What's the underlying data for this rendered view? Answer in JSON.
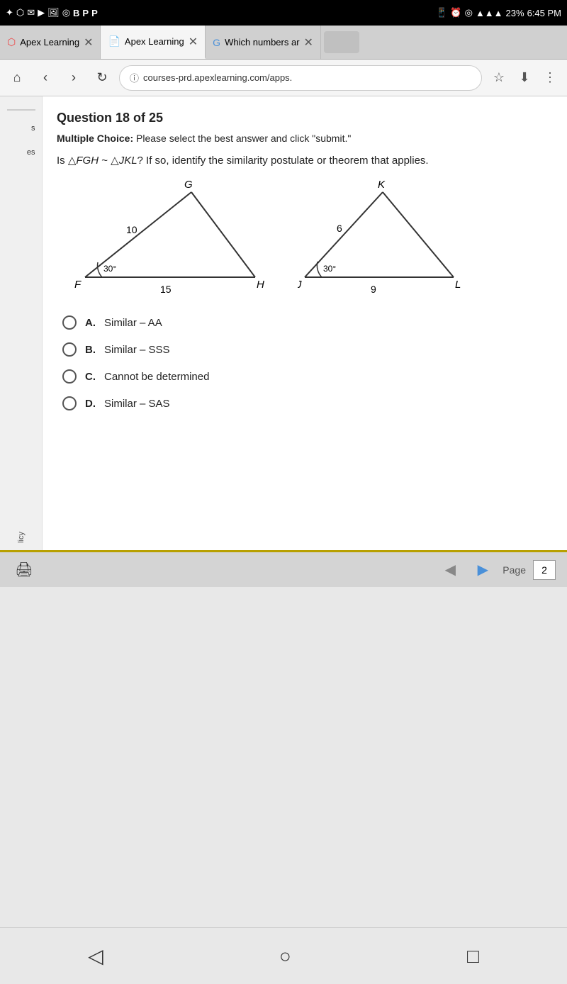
{
  "statusBar": {
    "time": "6:45 PM",
    "battery": "23%",
    "signal": "●●●"
  },
  "tabs": [
    {
      "id": "tab1",
      "label": "Apex Learning",
      "icon": "apex",
      "active": false
    },
    {
      "id": "tab2",
      "label": "Apex Learning",
      "icon": "doc",
      "active": true
    },
    {
      "id": "tab3",
      "label": "Which numbers ar",
      "icon": "google",
      "active": false
    }
  ],
  "addressBar": {
    "url": "courses-prd.apexlearning.com/apps."
  },
  "question": {
    "title": "Question 18 of 25",
    "instruction_bold": "Multiple Choice:",
    "instruction_text": " Please select the best answer and click \"submit.\"",
    "text": "Is △FGH ~ △JKL? If so, identify the similarity postulate or theorem that applies.",
    "triangle1": {
      "vertices": {
        "top": "G",
        "left": "F",
        "right": "H"
      },
      "sides": {
        "left": "10",
        "bottom": "15"
      },
      "angle": "30°"
    },
    "triangle2": {
      "vertices": {
        "top": "K",
        "left": "J",
        "right": "L"
      },
      "sides": {
        "left": "6",
        "bottom": "9"
      },
      "angle": "30°"
    },
    "choices": [
      {
        "letter": "A.",
        "text": "Similar – AA"
      },
      {
        "letter": "B.",
        "text": "Similar – SSS"
      },
      {
        "letter": "C.",
        "text": "Cannot be determined"
      },
      {
        "letter": "D.",
        "text": "Similar – SAS"
      }
    ]
  },
  "bottomBar": {
    "page_label": "Page",
    "page_num": "2"
  },
  "sidebarItems": [
    {
      "label": "s"
    },
    {
      "label": "es"
    }
  ],
  "policyLabel": "licy"
}
